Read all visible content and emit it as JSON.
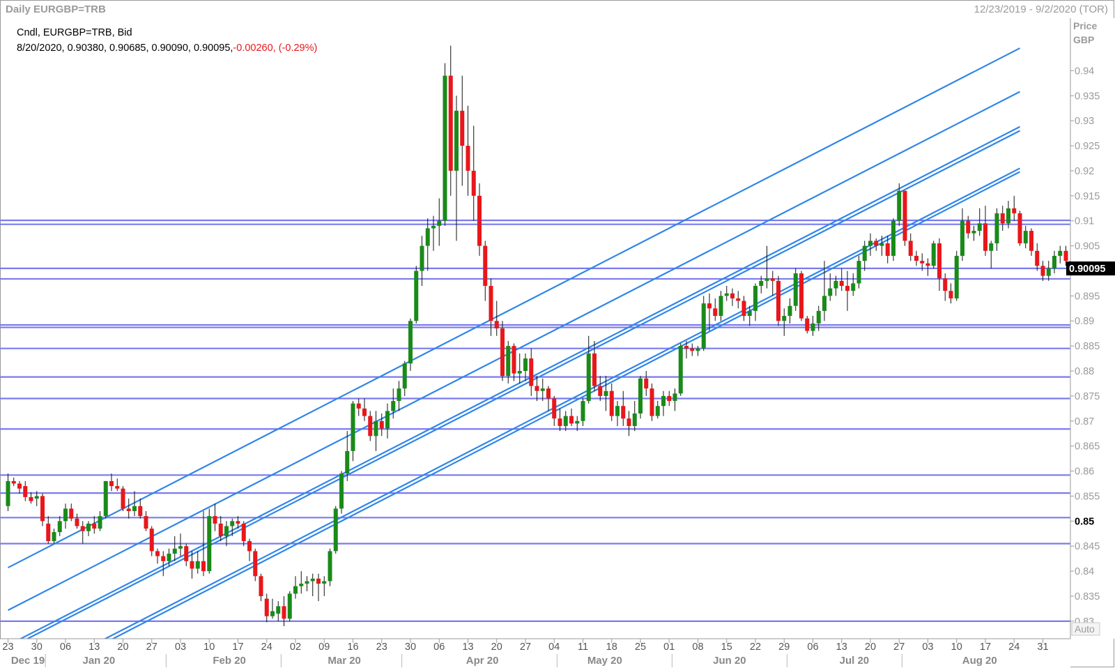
{
  "header": {
    "title": "Daily EURGBP=TRB",
    "date_range": "12/23/2019 - 9/2/2020 (TOR)"
  },
  "legend": {
    "line1": "Cndl, EURGBP=TRB, Bid",
    "line2_values": "8/20/2020, 0.90380, 0.90685, 0.90090, 0.90095,",
    "line2_change": "-0.00260, (-0.29%)"
  },
  "axis": {
    "price_label": "Price",
    "currency_label": "GBP",
    "auto_label": "Auto",
    "last_price": "0.90095"
  },
  "colors": {
    "up": "#1a8a1a",
    "down": "#e8171b",
    "hline": "#7a7aee",
    "channel": "#2f86e8",
    "text_grey": "#9a9a9a",
    "change_red": "#e8171b"
  },
  "chart_data": {
    "type": "candlestick",
    "title": "Daily EURGBP=TRB",
    "instrument": "EURGBP=TRB",
    "price_field": "Bid",
    "yunit": "GBP",
    "ylim": [
      0.8265,
      0.9505
    ],
    "y_ticks": [
      0.83,
      0.835,
      0.84,
      0.845,
      0.85,
      0.855,
      0.86,
      0.865,
      0.87,
      0.875,
      0.88,
      0.885,
      0.89,
      0.895,
      0.9,
      0.905,
      0.91,
      0.915,
      0.92,
      0.925,
      0.93,
      0.935,
      0.94,
      0.945
    ],
    "y_tick_labels": [
      "0.83",
      "0.835",
      "0.84",
      "0.845",
      "0.85",
      "0.855",
      "0.86",
      "0.865",
      "0.87",
      "0.875",
      "0.88",
      "0.885",
      "0.89",
      "0.895",
      "0.9",
      "0.905",
      "0.91",
      "0.915",
      "0.92",
      "0.925",
      "0.93",
      "0.935",
      "0.94",
      "0.945"
    ],
    "x_day_ticks": [
      "23",
      "30",
      "06",
      "13",
      "20",
      "27",
      "03",
      "10",
      "17",
      "24",
      "02",
      "09",
      "16",
      "23",
      "30",
      "06",
      "13",
      "20",
      "27",
      "04",
      "11",
      "18",
      "25",
      "01",
      "08",
      "15",
      "22",
      "29",
      "06",
      "13",
      "20",
      "27",
      "03",
      "10",
      "17",
      "24",
      "31"
    ],
    "x_month_labels": [
      "Dec 19",
      "Jan 20",
      "Feb 20",
      "Mar 20",
      "Apr 20",
      "May 20",
      "Jun 20",
      "Jul 20",
      "Aug 20"
    ],
    "last_candle": {
      "date": "8/20/2020",
      "open": 0.9038,
      "high": 0.90685,
      "low": 0.9009,
      "close": 0.90095
    },
    "horizontal_levels": [
      0.9101,
      0.9093,
      0.9005,
      0.8984,
      0.8892,
      0.8887,
      0.8845,
      0.8788,
      0.8745,
      0.8684,
      0.8592,
      0.8556,
      0.8507,
      0.8455,
      0.83
    ],
    "channel_lines": [
      {
        "start": [
          0,
          0.8407
        ],
        "end": [
          176,
          0.9445
        ]
      },
      {
        "start": [
          0,
          0.8322
        ],
        "end": [
          176,
          0.9358
        ]
      },
      {
        "start": [
          0,
          0.8252
        ],
        "end": [
          176,
          0.9288
        ]
      },
      {
        "start": [
          0,
          0.8245
        ],
        "end": [
          176,
          0.928
        ]
      },
      {
        "start": [
          0,
          0.8165
        ],
        "end": [
          176,
          0.9205
        ]
      },
      {
        "start": [
          0,
          0.8157
        ],
        "end": [
          176,
          0.9198
        ]
      }
    ],
    "candles": [
      [
        0.853,
        0.8595,
        0.852,
        0.858
      ],
      [
        0.858,
        0.8587,
        0.857,
        0.8575
      ],
      [
        0.8575,
        0.858,
        0.8555,
        0.8565
      ],
      [
        0.857,
        0.858,
        0.854,
        0.8548
      ],
      [
        0.8548,
        0.8558,
        0.8535,
        0.854
      ],
      [
        0.8545,
        0.856,
        0.853,
        0.855
      ],
      [
        0.855,
        0.8555,
        0.849,
        0.85
      ],
      [
        0.8495,
        0.851,
        0.8455,
        0.846
      ],
      [
        0.846,
        0.8485,
        0.8455,
        0.8478
      ],
      [
        0.8478,
        0.851,
        0.847,
        0.85
      ],
      [
        0.85,
        0.8535,
        0.8485,
        0.8525
      ],
      [
        0.8525,
        0.8535,
        0.85,
        0.8505
      ],
      [
        0.8505,
        0.8515,
        0.8485,
        0.849
      ],
      [
        0.849,
        0.85,
        0.8455,
        0.848
      ],
      [
        0.848,
        0.85,
        0.847,
        0.8495
      ],
      [
        0.8495,
        0.851,
        0.8475,
        0.8485
      ],
      [
        0.8485,
        0.852,
        0.848,
        0.851
      ],
      [
        0.851,
        0.858,
        0.8505,
        0.858
      ],
      [
        0.858,
        0.8595,
        0.856,
        0.857
      ],
      [
        0.857,
        0.8585,
        0.856,
        0.8565
      ],
      [
        0.8565,
        0.857,
        0.852,
        0.8525
      ],
      [
        0.8525,
        0.8545,
        0.8505,
        0.852
      ],
      [
        0.852,
        0.856,
        0.851,
        0.853
      ],
      [
        0.853,
        0.8545,
        0.8505,
        0.851
      ],
      [
        0.851,
        0.852,
        0.848,
        0.8485
      ],
      [
        0.8485,
        0.849,
        0.843,
        0.844
      ],
      [
        0.844,
        0.8445,
        0.8415,
        0.843
      ],
      [
        0.843,
        0.844,
        0.839,
        0.842
      ],
      [
        0.842,
        0.8445,
        0.841,
        0.8435
      ],
      [
        0.8435,
        0.847,
        0.842,
        0.8445
      ],
      [
        0.8445,
        0.8475,
        0.843,
        0.845
      ],
      [
        0.845,
        0.8455,
        0.841,
        0.842
      ],
      [
        0.842,
        0.844,
        0.8385,
        0.8405
      ],
      [
        0.8405,
        0.844,
        0.8395,
        0.842
      ],
      [
        0.842,
        0.852,
        0.839,
        0.84
      ],
      [
        0.84,
        0.8525,
        0.8395,
        0.851
      ],
      [
        0.851,
        0.8535,
        0.848,
        0.8495
      ],
      [
        0.8495,
        0.851,
        0.846,
        0.847
      ],
      [
        0.847,
        0.85,
        0.845,
        0.849
      ],
      [
        0.849,
        0.8505,
        0.847,
        0.85
      ],
      [
        0.85,
        0.851,
        0.8485,
        0.8495
      ],
      [
        0.8495,
        0.85,
        0.845,
        0.846
      ],
      [
        0.846,
        0.8465,
        0.842,
        0.844
      ],
      [
        0.844,
        0.8445,
        0.838,
        0.839
      ],
      [
        0.839,
        0.8395,
        0.834,
        0.835
      ],
      [
        0.8345,
        0.8355,
        0.8298,
        0.831
      ],
      [
        0.831,
        0.8345,
        0.8305,
        0.832
      ],
      [
        0.8315,
        0.834,
        0.83,
        0.833
      ],
      [
        0.833,
        0.835,
        0.829,
        0.8305
      ],
      [
        0.8305,
        0.836,
        0.83,
        0.8355
      ],
      [
        0.8355,
        0.839,
        0.8345,
        0.837
      ],
      [
        0.837,
        0.84,
        0.8355,
        0.8375
      ],
      [
        0.8375,
        0.839,
        0.836,
        0.838
      ],
      [
        0.838,
        0.8395,
        0.835,
        0.8385
      ],
      [
        0.8385,
        0.8395,
        0.834,
        0.8375
      ],
      [
        0.8375,
        0.839,
        0.835,
        0.838
      ],
      [
        0.838,
        0.8445,
        0.837,
        0.844
      ],
      [
        0.844,
        0.853,
        0.8435,
        0.8525
      ],
      [
        0.8525,
        0.86,
        0.8515,
        0.8595
      ],
      [
        0.8595,
        0.868,
        0.858,
        0.864
      ],
      [
        0.864,
        0.874,
        0.862,
        0.8735
      ],
      [
        0.8735,
        0.8745,
        0.871,
        0.8725
      ],
      [
        0.8725,
        0.8745,
        0.87,
        0.871
      ],
      [
        0.871,
        0.872,
        0.866,
        0.867
      ],
      [
        0.867,
        0.872,
        0.864,
        0.87
      ],
      [
        0.87,
        0.8715,
        0.867,
        0.8685
      ],
      [
        0.8685,
        0.8735,
        0.8665,
        0.872
      ],
      [
        0.872,
        0.8765,
        0.8705,
        0.874
      ],
      [
        0.874,
        0.878,
        0.872,
        0.8765
      ],
      [
        0.8765,
        0.882,
        0.875,
        0.8815
      ],
      [
        0.8815,
        0.8905,
        0.88,
        0.89
      ],
      [
        0.89,
        0.901,
        0.8895,
        0.9
      ],
      [
        0.9,
        0.907,
        0.897,
        0.905
      ],
      [
        0.905,
        0.9105,
        0.9,
        0.9085
      ],
      [
        0.9085,
        0.911,
        0.904,
        0.909
      ],
      [
        0.909,
        0.9145,
        0.905,
        0.91
      ],
      [
        0.91,
        0.9415,
        0.909,
        0.939
      ],
      [
        0.939,
        0.945,
        0.915,
        0.92
      ],
      [
        0.92,
        0.935,
        0.906,
        0.932
      ],
      [
        0.932,
        0.939,
        0.917,
        0.925
      ],
      [
        0.925,
        0.933,
        0.915,
        0.92
      ],
      [
        0.92,
        0.929,
        0.91,
        0.915
      ],
      [
        0.915,
        0.9175,
        0.903,
        0.905
      ],
      [
        0.905,
        0.906,
        0.894,
        0.897
      ],
      [
        0.897,
        0.8985,
        0.887,
        0.89
      ],
      [
        0.89,
        0.894,
        0.887,
        0.8885
      ],
      [
        0.8885,
        0.89,
        0.878,
        0.879
      ],
      [
        0.879,
        0.886,
        0.8775,
        0.885
      ],
      [
        0.885,
        0.8855,
        0.878,
        0.8795
      ],
      [
        0.8795,
        0.8835,
        0.8775,
        0.88
      ],
      [
        0.88,
        0.8835,
        0.878,
        0.8825
      ],
      [
        0.8825,
        0.8845,
        0.875,
        0.877
      ],
      [
        0.877,
        0.879,
        0.874,
        0.876
      ],
      [
        0.876,
        0.8785,
        0.874,
        0.8765
      ],
      [
        0.8765,
        0.877,
        0.872,
        0.8745
      ],
      [
        0.8745,
        0.875,
        0.869,
        0.8705
      ],
      [
        0.8705,
        0.8725,
        0.868,
        0.869
      ],
      [
        0.869,
        0.872,
        0.868,
        0.871
      ],
      [
        0.871,
        0.8725,
        0.869,
        0.8695
      ],
      [
        0.8695,
        0.871,
        0.868,
        0.87
      ],
      [
        0.87,
        0.8745,
        0.869,
        0.874
      ],
      [
        0.874,
        0.887,
        0.8735,
        0.8835
      ],
      [
        0.8835,
        0.886,
        0.876,
        0.877
      ],
      [
        0.877,
        0.879,
        0.874,
        0.875
      ],
      [
        0.875,
        0.879,
        0.872,
        0.876
      ],
      [
        0.876,
        0.8775,
        0.87,
        0.871
      ],
      [
        0.871,
        0.874,
        0.869,
        0.873
      ],
      [
        0.873,
        0.876,
        0.869,
        0.8705
      ],
      [
        0.8705,
        0.872,
        0.867,
        0.869
      ],
      [
        0.869,
        0.874,
        0.868,
        0.8715
      ],
      [
        0.8715,
        0.879,
        0.8705,
        0.8785
      ],
      [
        0.8785,
        0.88,
        0.875,
        0.8765
      ],
      [
        0.8765,
        0.8775,
        0.87,
        0.871
      ],
      [
        0.871,
        0.874,
        0.8705,
        0.873
      ],
      [
        0.873,
        0.876,
        0.871,
        0.875
      ],
      [
        0.875,
        0.876,
        0.873,
        0.874
      ],
      [
        0.874,
        0.8765,
        0.872,
        0.8755
      ],
      [
        0.8755,
        0.8855,
        0.875,
        0.885
      ],
      [
        0.885,
        0.886,
        0.8825,
        0.8845
      ],
      [
        0.8845,
        0.8855,
        0.883,
        0.884
      ],
      [
        0.884,
        0.885,
        0.883,
        0.8845
      ],
      [
        0.8845,
        0.895,
        0.884,
        0.8935
      ],
      [
        0.8935,
        0.8955,
        0.888,
        0.8925
      ],
      [
        0.8925,
        0.8945,
        0.89,
        0.891
      ],
      [
        0.891,
        0.896,
        0.89,
        0.895
      ],
      [
        0.895,
        0.897,
        0.894,
        0.8955
      ],
      [
        0.8955,
        0.8965,
        0.893,
        0.8945
      ],
      [
        0.8945,
        0.896,
        0.8925,
        0.894
      ],
      [
        0.894,
        0.895,
        0.89,
        0.891
      ],
      [
        0.891,
        0.893,
        0.889,
        0.892
      ],
      [
        0.892,
        0.8975,
        0.89,
        0.897
      ],
      [
        0.897,
        0.899,
        0.8955,
        0.898
      ],
      [
        0.898,
        0.905,
        0.8965,
        0.8985
      ],
      [
        0.8985,
        0.9,
        0.895,
        0.898
      ],
      [
        0.898,
        0.899,
        0.889,
        0.89
      ],
      [
        0.89,
        0.8925,
        0.887,
        0.891
      ],
      [
        0.891,
        0.8945,
        0.8895,
        0.893
      ],
      [
        0.893,
        0.9005,
        0.892,
        0.8995
      ],
      [
        0.8995,
        0.9,
        0.89,
        0.8905
      ],
      [
        0.8905,
        0.891,
        0.8875,
        0.888
      ],
      [
        0.888,
        0.891,
        0.887,
        0.8895
      ],
      [
        0.8895,
        0.893,
        0.888,
        0.892
      ],
      [
        0.892,
        0.902,
        0.89,
        0.895
      ],
      [
        0.895,
        0.8995,
        0.894,
        0.8965
      ],
      [
        0.8965,
        0.899,
        0.895,
        0.898
      ],
      [
        0.898,
        0.9005,
        0.896,
        0.897
      ],
      [
        0.897,
        0.9,
        0.892,
        0.896
      ],
      [
        0.896,
        0.8995,
        0.895,
        0.8975
      ],
      [
        0.8975,
        0.903,
        0.8965,
        0.902
      ],
      [
        0.902,
        0.906,
        0.9,
        0.905
      ],
      [
        0.905,
        0.9075,
        0.903,
        0.906
      ],
      [
        0.906,
        0.9065,
        0.904,
        0.905
      ],
      [
        0.905,
        0.907,
        0.903,
        0.9055
      ],
      [
        0.9055,
        0.907,
        0.9015,
        0.903
      ],
      [
        0.903,
        0.9105,
        0.902,
        0.91
      ],
      [
        0.91,
        0.9175,
        0.909,
        0.916
      ],
      [
        0.916,
        0.916,
        0.905,
        0.906
      ],
      [
        0.906,
        0.9075,
        0.902,
        0.903
      ],
      [
        0.903,
        0.904,
        0.901,
        0.902
      ],
      [
        0.902,
        0.9035,
        0.9,
        0.9015
      ],
      [
        0.9015,
        0.9025,
        0.899,
        0.901
      ],
      [
        0.901,
        0.906,
        0.9005,
        0.9055
      ],
      [
        0.9055,
        0.9065,
        0.896,
        0.8985
      ],
      [
        0.8985,
        0.8995,
        0.894,
        0.896
      ],
      [
        0.896,
        0.8975,
        0.8935,
        0.8945
      ],
      [
        0.8945,
        0.904,
        0.894,
        0.903
      ],
      [
        0.903,
        0.9125,
        0.902,
        0.91
      ],
      [
        0.91,
        0.911,
        0.9065,
        0.9075
      ],
      [
        0.9075,
        0.909,
        0.906,
        0.908
      ],
      [
        0.908,
        0.9125,
        0.907,
        0.9095
      ],
      [
        0.9095,
        0.913,
        0.903,
        0.904
      ],
      [
        0.904,
        0.906,
        0.9005,
        0.9055
      ],
      [
        0.9055,
        0.9125,
        0.904,
        0.9115
      ],
      [
        0.9115,
        0.913,
        0.908,
        0.9095
      ],
      [
        0.9095,
        0.914,
        0.9085,
        0.9125
      ],
      [
        0.9125,
        0.915,
        0.91,
        0.9115
      ],
      [
        0.9115,
        0.912,
        0.905,
        0.9055
      ],
      [
        0.9055,
        0.909,
        0.9045,
        0.908
      ],
      [
        0.908,
        0.9085,
        0.903,
        0.904
      ],
      [
        0.904,
        0.9055,
        0.9,
        0.901
      ],
      [
        0.901,
        0.902,
        0.898,
        0.899
      ],
      [
        0.899,
        0.902,
        0.898,
        0.9005
      ],
      [
        0.9005,
        0.904,
        0.8995,
        0.903
      ],
      [
        0.903,
        0.905,
        0.9015,
        0.904
      ],
      [
        0.904,
        0.905,
        0.901,
        0.902
      ],
      [
        0.902,
        0.9035,
        0.9,
        0.9015
      ],
      [
        0.9015,
        0.9025,
        0.897,
        0.8975
      ],
      [
        0.8975,
        0.899,
        0.8965,
        0.8985
      ],
      [
        0.8985,
        0.901,
        0.898,
        0.8995
      ],
      [
        0.8995,
        0.904,
        0.8985,
        0.903
      ],
      [
        0.903,
        0.9045,
        0.9015,
        0.9035
      ],
      [
        0.9035,
        0.905,
        0.9025,
        0.904
      ],
      [
        0.904,
        0.906,
        0.903,
        0.905
      ],
      [
        0.905,
        0.9055,
        0.9005,
        0.901
      ],
      [
        0.901,
        0.904,
        0.9,
        0.9038
      ],
      [
        0.9038,
        0.90685,
        0.9009,
        0.90095
      ]
    ]
  }
}
